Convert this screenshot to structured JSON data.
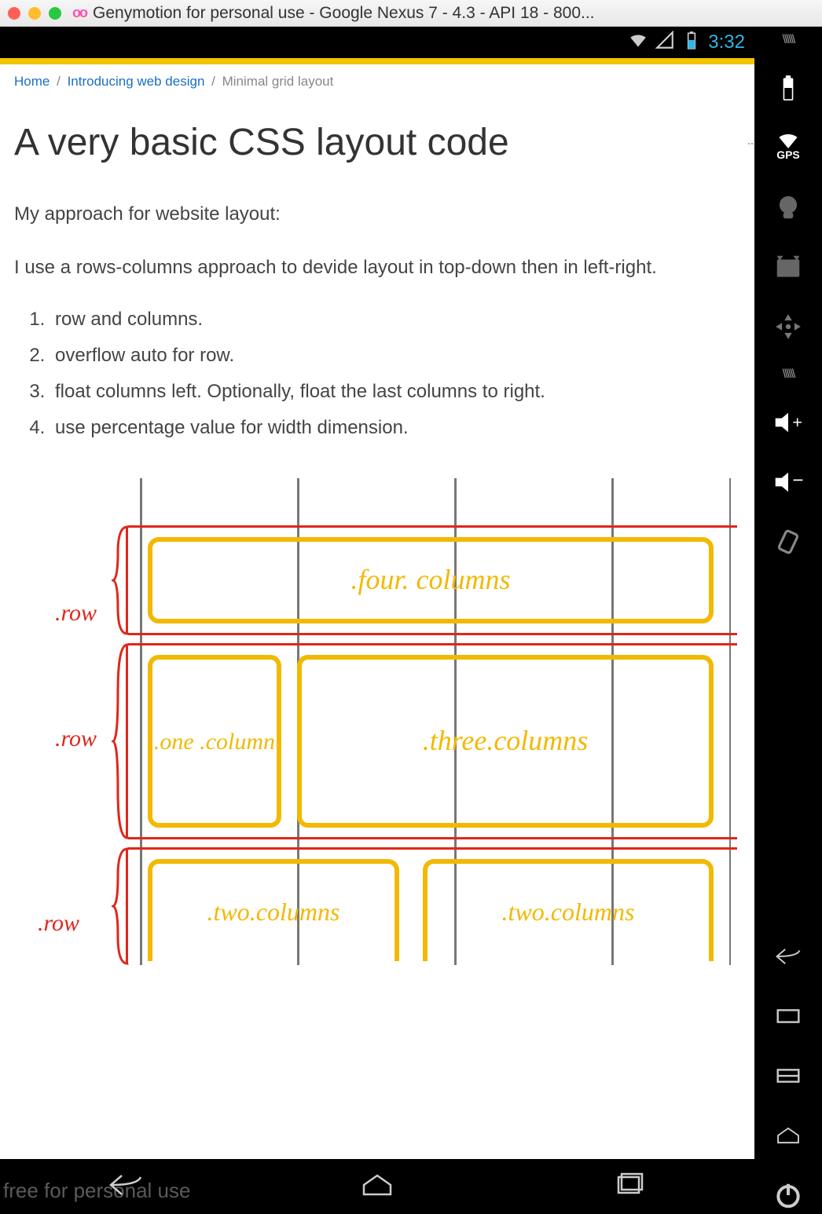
{
  "window": {
    "title": "Genymotion for personal use - Google Nexus 7 - 4.3 - API 18 - 800..."
  },
  "status_bar": {
    "time": "3:32"
  },
  "breadcrumb": {
    "home": "Home",
    "section": "Introducing web design",
    "current": "Minimal grid layout"
  },
  "page": {
    "title": "A very basic CSS layout code",
    "intro": "My approach for website layout:",
    "paragraph": "I use a rows-columns approach to devide layout in top-down then in left-right.",
    "steps": [
      "row and columns.",
      "overflow auto for row.",
      "float columns left. Optionally, float the last columns to right.",
      "use percentage value for width dimension."
    ]
  },
  "diagram": {
    "row_labels": [
      ".row",
      ".row",
      ".row"
    ],
    "rows": [
      {
        "cols": [
          {
            "label": ".four. columns"
          }
        ]
      },
      {
        "cols": [
          {
            "label": ".one .column"
          },
          {
            "label": ".three.columns"
          }
        ]
      },
      {
        "cols": [
          {
            "label": ".two.columns"
          },
          {
            "label": ".two.columns"
          }
        ]
      }
    ]
  },
  "side_tools": {
    "gps_label": "GPS"
  },
  "watermark": "free for personal use"
}
